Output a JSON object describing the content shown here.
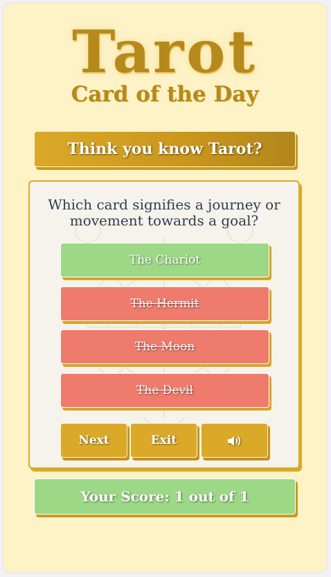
{
  "app": {
    "title": "Tarot",
    "subtitle": "Card of the Day"
  },
  "banner": {
    "label": "Think you know Tarot?"
  },
  "quiz": {
    "question": "Which card signifies a journey or movement towards a goal?",
    "answers": [
      {
        "label": "The Chariot",
        "state": "correct"
      },
      {
        "label": "The Hermit",
        "state": "wrong"
      },
      {
        "label": "The Moon",
        "state": "wrong"
      },
      {
        "label": "The Devil",
        "state": "wrong"
      }
    ],
    "controls": {
      "next_label": "Next",
      "exit_label": "Exit",
      "sound_icon": "speaker-volume-icon"
    }
  },
  "score": {
    "label": "Your Score: 1 out of 1"
  },
  "colors": {
    "background": "#fdf3c7",
    "gold": "#dba928",
    "correct": "#9dd886",
    "wrong": "#ef7b6d",
    "question_text": "#2c3e50"
  }
}
